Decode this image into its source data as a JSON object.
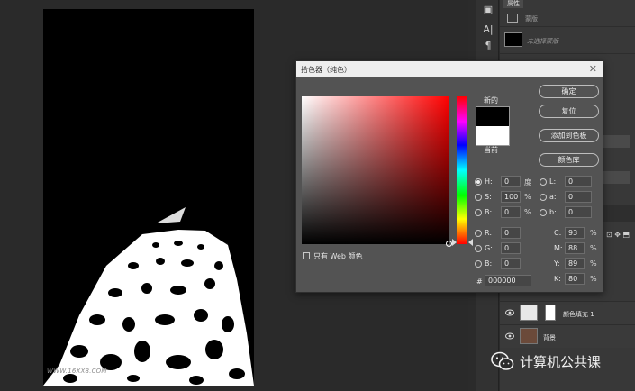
{
  "canvas": {
    "watermark": "WWW.16XX8.COM"
  },
  "right_panel": {
    "tab": "属性",
    "row1_label": "蒙版",
    "row2_label": "未选择蒙版",
    "layers": [
      {
        "name": "颜色填充 1"
      },
      {
        "name": "背景"
      }
    ]
  },
  "brand": {
    "text": "计算机公共课"
  },
  "dialog": {
    "title": "拾色器（纯色）",
    "close": "✕",
    "new_label": "新的",
    "current_label": "当前",
    "buttons": {
      "ok": "确定",
      "reset": "复位",
      "add_swatch": "添加到色板",
      "libraries": "颜色库"
    },
    "web_only": "只有 Web 颜色",
    "hsb": {
      "h_label": "H:",
      "h_value": "0",
      "h_unit": "度",
      "s_label": "S:",
      "s_value": "100",
      "s_unit": "%",
      "b_label": "B:",
      "b_value": "0",
      "b_unit": "%"
    },
    "rgb": {
      "r_label": "R:",
      "r_value": "0",
      "g_label": "G:",
      "g_value": "0",
      "b_label": "B:",
      "b_value": "0"
    },
    "lab": {
      "l_label": "L:",
      "l_value": "0",
      "a_label": "a:",
      "a_value": "0",
      "b_label": "b:",
      "b_value": "0"
    },
    "cmyk": {
      "c_label": "C:",
      "c_value": "93",
      "c_unit": "%",
      "m_label": "M:",
      "m_value": "88",
      "m_unit": "%",
      "y_label": "Y:",
      "y_value": "89",
      "y_unit": "%",
      "k_label": "K:",
      "k_value": "80",
      "k_unit": "%"
    },
    "hex_label": "#",
    "hex_value": "000000"
  },
  "colors": {
    "selected": "#000000",
    "current": "#ffffff",
    "hue": "#ff0000"
  }
}
